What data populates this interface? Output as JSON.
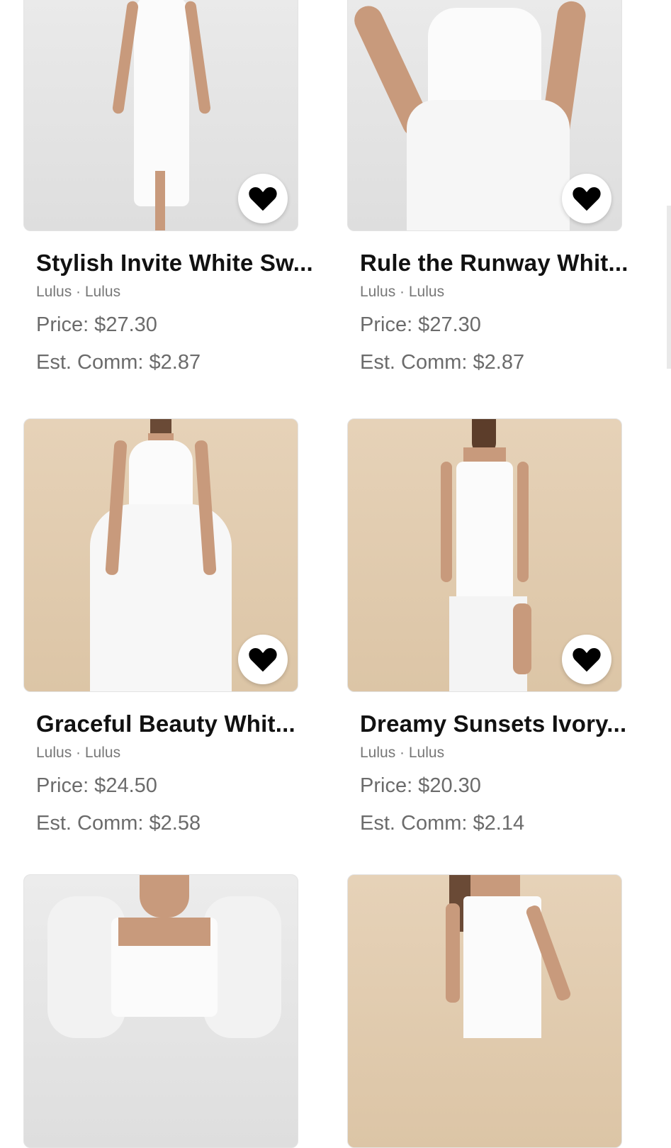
{
  "products": [
    {
      "title": "Stylish Invite White Sw...",
      "brand": "Lulus · Lulus",
      "price": "Price: $27.30",
      "commission": "Est. Comm: $2.87",
      "favorited": true,
      "icon": "heart-icon",
      "background": "#e6e6e6"
    },
    {
      "title": "Rule the Runway Whit...",
      "brand": "Lulus · Lulus",
      "price": "Price: $27.30",
      "commission": "Est. Comm: $2.87",
      "favorited": true,
      "icon": "heart-icon",
      "background": "#e6e6e6"
    },
    {
      "title": "Graceful Beauty Whit...",
      "brand": "Lulus · Lulus",
      "price": "Price: $24.50",
      "commission": "Est. Comm: $2.58",
      "favorited": true,
      "icon": "heart-icon",
      "background": "#e0caac"
    },
    {
      "title": "Dreamy Sunsets Ivory...",
      "brand": "Lulus · Lulus",
      "price": "Price: $20.30",
      "commission": "Est. Comm: $2.14",
      "favorited": true,
      "icon": "heart-icon",
      "background": "#e0caac"
    },
    {
      "background": "#e6e6e6"
    },
    {
      "background": "#e0caac"
    }
  ],
  "colors": {
    "heart": "#000000",
    "title": "#111111",
    "muted": "#6b6b6b"
  }
}
